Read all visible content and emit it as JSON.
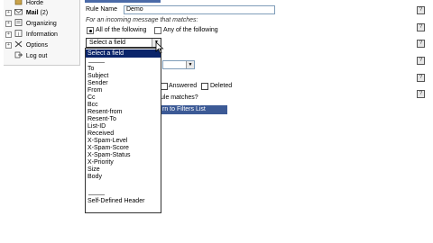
{
  "sidebar": {
    "items": [
      {
        "label": "Horde",
        "icon": "horde-icon",
        "expandable": false,
        "bold": false
      },
      {
        "label": "Mail",
        "count": "(2)",
        "icon": "mail-icon",
        "expandable": true,
        "bold": true
      },
      {
        "label": "Organizing",
        "icon": "organizing-icon",
        "expandable": true,
        "bold": false
      },
      {
        "label": "Information",
        "icon": "information-icon",
        "expandable": true,
        "bold": false
      },
      {
        "label": "Options",
        "icon": "options-icon",
        "expandable": true,
        "bold": false
      },
      {
        "label": "Log out",
        "icon": "logout-icon",
        "expandable": false,
        "bold": false
      }
    ]
  },
  "form": {
    "rule_name_label": "Rule Name",
    "rule_name_value": "Demo",
    "match_caption": "For an incoming message that matches:",
    "radio_all_label": "All of the following",
    "radio_any_label": "Any of the following",
    "field_select_value": "Select a field",
    "answered_label": "Answered",
    "deleted_label": "Deleted",
    "rule_matches_text": "ule matches?",
    "return_button_label": "rn to Filters List"
  },
  "dropdown": {
    "options": [
      "Select a field",
      "",
      "To",
      "Subject",
      "Sender",
      "From",
      "Cc",
      "Bcc",
      "Resent-from",
      "Resent-To",
      "List-ID",
      "Received",
      "X-Spam-Level",
      "X-Spam-Score",
      "X-Spam-Status",
      "X-Priority",
      "Size",
      "Body",
      "",
      "Self-Defined Header"
    ],
    "selected": "Select a field"
  },
  "help_icon": {
    "glyph": "?",
    "count": 6
  },
  "colors": {
    "selection": "#0a246a",
    "action_bar": "#3c5a96",
    "sidebar_bg": "#f7f7f7"
  }
}
